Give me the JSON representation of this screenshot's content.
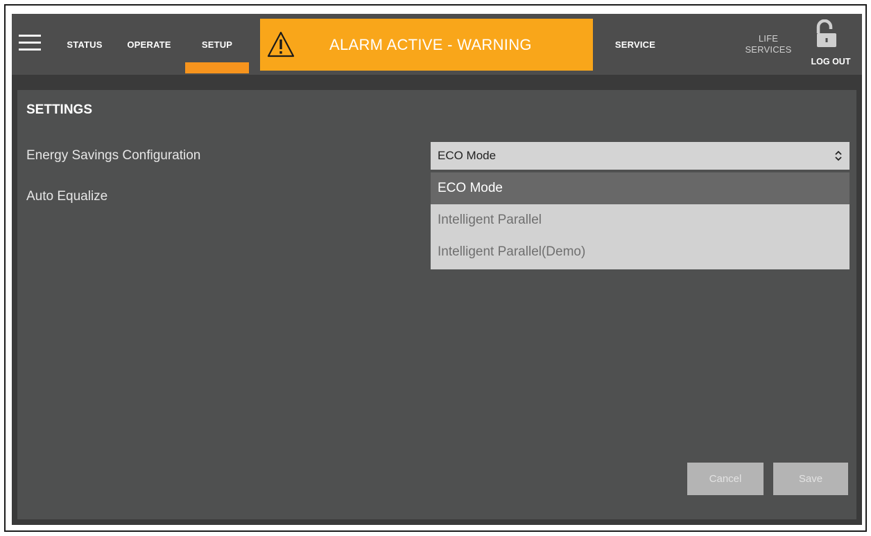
{
  "nav": {
    "status": "STATUS",
    "operate": "OPERATE",
    "setup": "SETUP",
    "service": "SERVICE",
    "life_line1": "LIFE",
    "life_line2": "SERVICES",
    "logout": "LOG OUT",
    "active_tab": "SETUP",
    "menu_icon": "hamburger-icon",
    "lock_icon": "unlocked-padlock-icon"
  },
  "alarm": {
    "text": "ALARM ACTIVE - WARNING",
    "icon": "warning-triangle-icon",
    "color": "#f9a61a"
  },
  "settings": {
    "title": "SETTINGS",
    "energy_label": "Energy Savings Configuration",
    "auto_equalize_label": "Auto Equalize",
    "energy_select": {
      "value": "ECO Mode",
      "options": [
        "ECO Mode",
        "Intelligent Parallel",
        "Intelligent Parallel(Demo)"
      ],
      "selected_index": 0
    }
  },
  "actions": {
    "cancel": "Cancel",
    "save": "Save"
  },
  "colors": {
    "accent": "#f7941d",
    "topbar": "#4d4d4d",
    "panel": "#4f5050"
  }
}
